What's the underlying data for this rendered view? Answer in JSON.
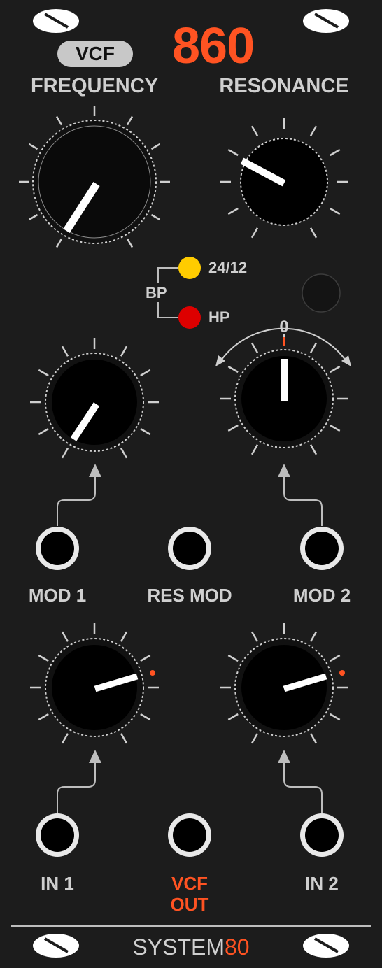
{
  "header": {
    "badge": "VCF",
    "model_number": "860"
  },
  "colors": {
    "panel": "#1c1c1c",
    "label": "#cfcfcf",
    "accent": "#ff5322",
    "led_24_12": "#ffcc00",
    "led_hp": "#dd0000"
  },
  "knob_labels": {
    "frequency": "FREQUENCY",
    "resonance": "RESONANCE"
  },
  "mode": {
    "bp": "BP",
    "option_1": "24/12",
    "option_2": "HP"
  },
  "mod2_center": "0",
  "jacks": {
    "mod1": "MOD 1",
    "res_mod": "RES MOD",
    "mod2": "MOD 2",
    "in1": "IN 1",
    "in2": "IN 2",
    "out_line1": "VCF",
    "out_line2": "OUT"
  },
  "footer": {
    "brand": "SYSTEM",
    "brand_number": "80"
  }
}
